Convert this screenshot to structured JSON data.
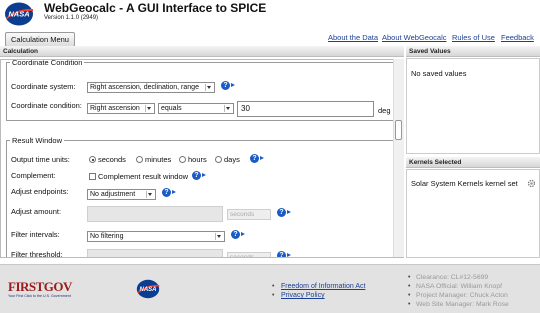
{
  "header": {
    "title": "WebGeocalc - A GUI Interface to SPICE",
    "version": "Version 1.1.0 (2949)",
    "logo_text": "NASA"
  },
  "toolbar": {
    "menu_label": "Calculation Menu",
    "links": [
      "About the Data",
      "About WebGeocalc",
      "Rules of Use",
      "Feedback"
    ]
  },
  "calculation": {
    "heading": "Calculation",
    "coordinate_condition": {
      "legend": "Coordinate Condition",
      "system_label": "Coordinate system:",
      "system_value": "Right ascension, declination, range",
      "condition_label": "Coordinate condition:",
      "coordinate_value": "Right ascension",
      "relation_value": "equals",
      "value": "30",
      "unit": "deg"
    },
    "result_window": {
      "legend": "Result Window",
      "output_units_label": "Output time units:",
      "units": [
        "seconds",
        "minutes",
        "hours",
        "days"
      ],
      "selected_unit": "seconds",
      "complement_label": "Complement:",
      "complement_option": "Complement result window",
      "adjust_endpoints_label": "Adjust endpoints:",
      "adjust_endpoints_value": "No adjustment",
      "adjust_amount_label": "Adjust amount:",
      "adjust_amount_unit": "seconds",
      "filter_intervals_label": "Filter intervals:",
      "filter_intervals_value": "No filtering",
      "filter_threshold_label": "Filter threshold:",
      "filter_threshold_unit": "seconds"
    }
  },
  "saved_values": {
    "heading": "Saved Values",
    "empty_text": "No saved values"
  },
  "kernels": {
    "heading": "Kernels Selected",
    "item": "Solar System Kernels kernel set"
  },
  "footer": {
    "firstgov": "FIRSTGOV",
    "firstgov_tagline": "Your First Click to the U.S. Government",
    "nasa_logo_text": "NASA",
    "links": [
      "Freedom of Information Act",
      "Privacy Policy"
    ],
    "credits": [
      "Clearance: CL#12-5699",
      "NASA Official: William Knopf",
      "Project Manager: Chuck Acton",
      "Web Site Manager: Mark Rose"
    ]
  },
  "colors": {
    "link": "#1c3f94",
    "help_icon": "#1a5bc4",
    "nasa_blue": "#0b3d91",
    "nasa_red": "#fc3d21"
  }
}
